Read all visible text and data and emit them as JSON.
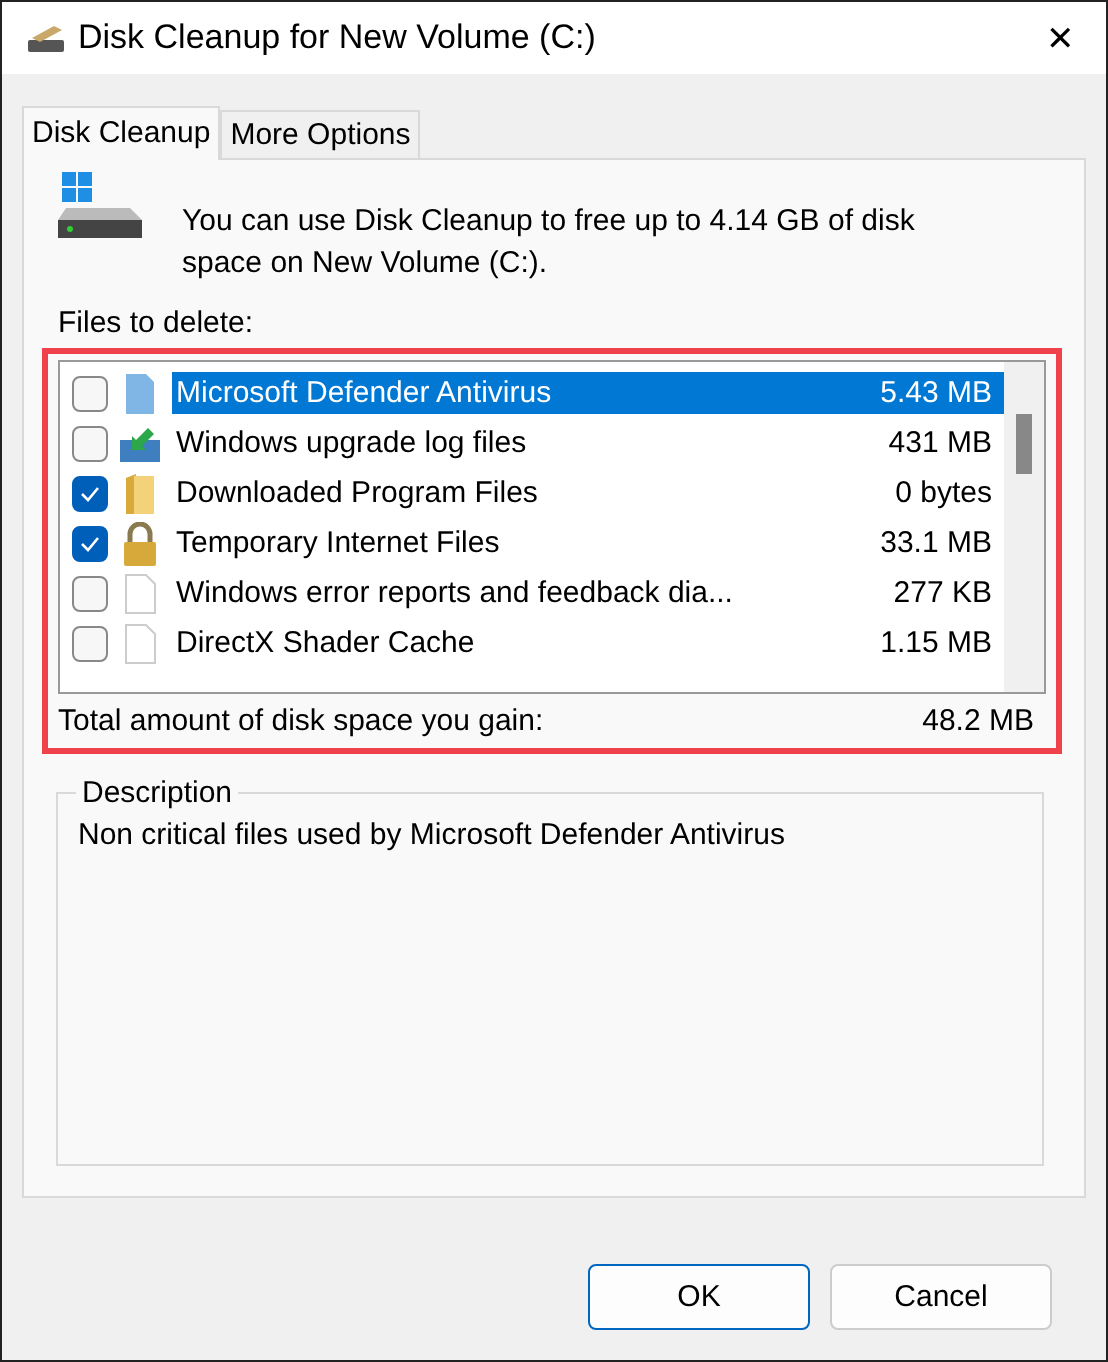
{
  "window": {
    "title": "Disk Cleanup for New Volume (C:)",
    "close": "✕"
  },
  "tabs": [
    {
      "label": "Disk Cleanup",
      "selected": true
    },
    {
      "label": "More Options",
      "selected": false
    }
  ],
  "intro": "You can use Disk Cleanup to free up to 4.14 GB of disk space on New Volume (C:).",
  "files_label": "Files to delete:",
  "files": [
    {
      "name": "Microsoft Defender Antivirus",
      "size": "5.43 MB",
      "checked": false,
      "selected": true,
      "kind": "blue-file"
    },
    {
      "name": "Windows upgrade log files",
      "size": "431 MB",
      "checked": false,
      "selected": false,
      "kind": "upgrade"
    },
    {
      "name": "Downloaded Program Files",
      "size": "0 bytes",
      "checked": true,
      "selected": false,
      "kind": "folder"
    },
    {
      "name": "Temporary Internet Files",
      "size": "33.1 MB",
      "checked": true,
      "selected": false,
      "kind": "lock"
    },
    {
      "name": "Windows error reports and feedback dia...",
      "size": "277 KB",
      "checked": false,
      "selected": false,
      "kind": "file"
    },
    {
      "name": "DirectX Shader Cache",
      "size": "1.15 MB",
      "checked": false,
      "selected": false,
      "kind": "file"
    }
  ],
  "total": {
    "label": "Total amount of disk space you gain:",
    "value": "48.2 MB"
  },
  "description": {
    "title": "Description",
    "text": "Non critical files used by Microsoft Defender Antivirus"
  },
  "buttons": [
    "OK",
    "Cancel"
  ]
}
